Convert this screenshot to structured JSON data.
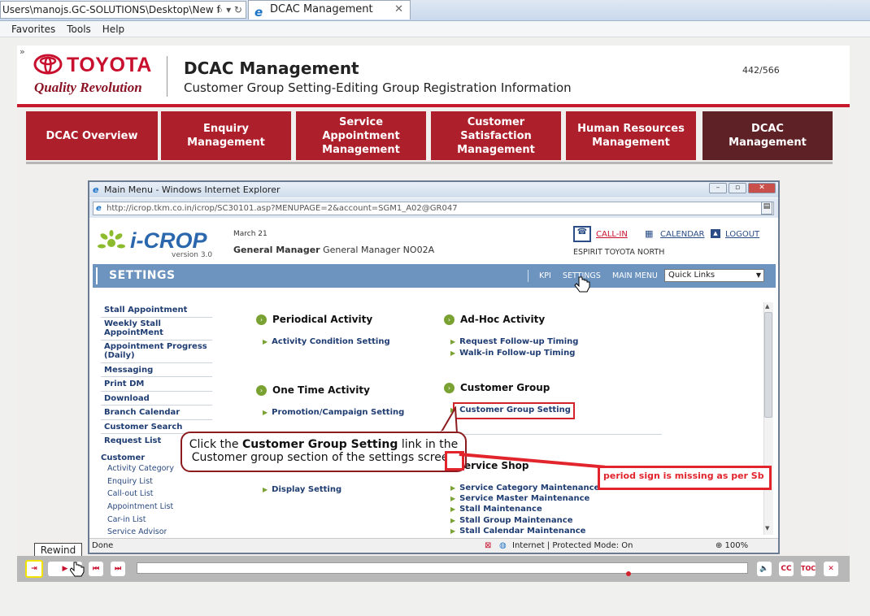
{
  "browser": {
    "address": "Users\\manojs.GC-SOLUTIONS\\Desktop\\New f",
    "addr_tools": "⌕ ▾ ↻",
    "tab_title": "DCAC Management",
    "menu": [
      "Favorites",
      "Tools",
      "Help"
    ]
  },
  "header": {
    "brand": "TOYOTA",
    "tagline": "Quality Revolution",
    "title": "DCAC Management",
    "subtitle": "Customer Group Setting-Editing Group Registration Information",
    "page_count": "442/566"
  },
  "nav": [
    {
      "label": "DCAC Overview"
    },
    {
      "label": "Enquiry Management"
    },
    {
      "label": "Service Appointment Management"
    },
    {
      "label": "Customer Satisfaction Management"
    },
    {
      "label": "Human Resources Management"
    },
    {
      "label": "DCAC Management"
    }
  ],
  "inner": {
    "window_title": "Main Menu  - Windows Internet Explorer",
    "url": "http://icrop.tkm.co.in/icrop/SC30101.asp?MENUPAGE=2&account=SGM1_A02@GR047",
    "app_name": "i-CROP",
    "version": "version 3.0",
    "date": "March 21",
    "gm_label": "General Manager",
    "gm_value": "General Manager NO02A",
    "callin": "CALL-IN",
    "calendar": "CALENDAR",
    "logout": "LOGOUT",
    "dealer": "ESPIRIT TOYOTA NORTH",
    "settings_title": "SETTINGS",
    "bar_links": [
      "KPI",
      "SETTINGS",
      "MAIN MENU"
    ],
    "quick_links": "Quick Links",
    "side_menu": [
      "Stall Appointment",
      "Weekly Stall AppointMent",
      "Appointment Progress (Daily)",
      "Messaging",
      "Print DM",
      "Download",
      "Branch Calendar",
      "Customer Search",
      "Request List"
    ],
    "side_customer": "Customer",
    "side_customer_items": [
      "Activity Category",
      "Enquiry List",
      "Call-out List",
      "Appointment List",
      "Car-in List",
      "Service Advisor"
    ],
    "sections": {
      "periodical": {
        "title": "Periodical Activity",
        "links": [
          "Activity Condition Setting"
        ]
      },
      "adhoc": {
        "title": "Ad-Hoc Activity",
        "links": [
          "Request Follow-up Timing",
          "Walk-in Follow-up Timing"
        ]
      },
      "onetime": {
        "title": "One Time Activity",
        "links": [
          "Promotion/Campaign Setting"
        ]
      },
      "custgroup": {
        "title": "Customer Group",
        "links": [
          "Customer Group Setting"
        ]
      },
      "display": {
        "links": [
          "Display Setting"
        ]
      },
      "service": {
        "title": "ervice Shop",
        "links": [
          "Service Category Maintenance",
          "Service Master Maintenance",
          "Stall Maintenance",
          "Stall Group Maintenance",
          "Stall Calendar Maintenance"
        ]
      }
    },
    "status_done": "Done",
    "status_zone": "Internet | Protected Mode: On",
    "status_zoom": "⊕ 100%"
  },
  "callout": {
    "prefix": "Click the ",
    "bold": "Customer Group Setting",
    "suffix": " link in the",
    "line2": "Customer group section of the settings screen"
  },
  "review_note": "period sign is missing as per Sb",
  "player": {
    "tooltip": "Rewind",
    "progress": 0.805,
    "buttons": [
      "exit",
      "play",
      "prev",
      "next",
      "volume",
      "CC",
      "TOC",
      "close"
    ]
  }
}
